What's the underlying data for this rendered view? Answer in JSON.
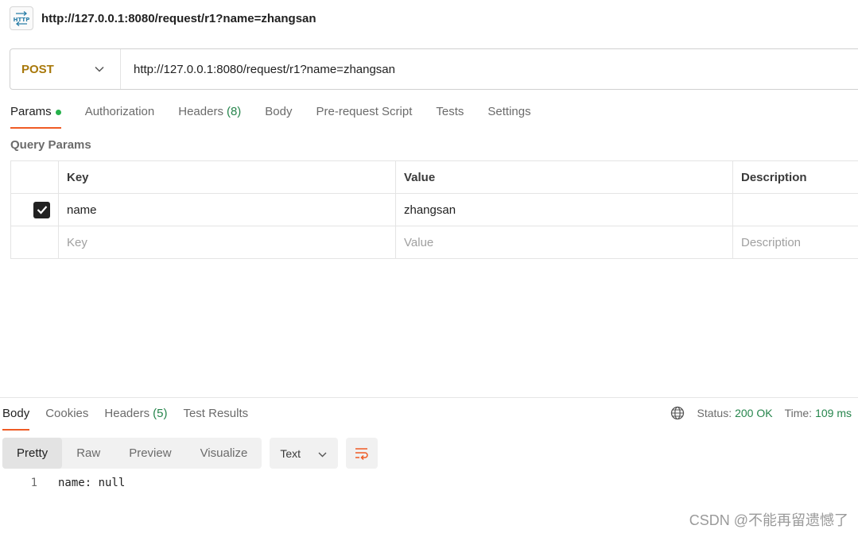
{
  "title_bar": {
    "icon": "http-icon",
    "title": "http://127.0.0.1:8080/request/r1?name=zhangsan"
  },
  "request": {
    "method": "POST",
    "url": "http://127.0.0.1:8080/request/r1?name=zhangsan",
    "tabs": [
      {
        "label": "Params",
        "active": true,
        "dot": true
      },
      {
        "label": "Authorization"
      },
      {
        "label": "Headers",
        "count": "(8)"
      },
      {
        "label": "Body"
      },
      {
        "label": "Pre-request Script"
      },
      {
        "label": "Tests"
      },
      {
        "label": "Settings"
      }
    ]
  },
  "query_params": {
    "title": "Query Params",
    "headers": [
      "Key",
      "Value",
      "Description"
    ],
    "rows": [
      {
        "checked": true,
        "key": "name",
        "value": "zhangsan",
        "description": ""
      }
    ],
    "placeholders": {
      "key": "Key",
      "value": "Value",
      "description": "Description"
    }
  },
  "response": {
    "tabs": [
      {
        "label": "Body",
        "active": true
      },
      {
        "label": "Cookies"
      },
      {
        "label": "Headers",
        "count": "(5)"
      },
      {
        "label": "Test Results"
      }
    ],
    "status_label": "Status:",
    "status_value": "200 OK",
    "time_label": "Time:",
    "time_value": "109 ms",
    "views": [
      "Pretty",
      "Raw",
      "Preview",
      "Visualize"
    ],
    "active_view": "Pretty",
    "format": "Text",
    "body_lines": [
      {
        "no": "1",
        "text": "name: null"
      }
    ]
  },
  "watermark": "CSDN @不能再留遗憾了",
  "colors": {
    "accent": "#ef5b25",
    "method": "#a8780a",
    "success": "#26854c",
    "dot": "#26b14b"
  }
}
